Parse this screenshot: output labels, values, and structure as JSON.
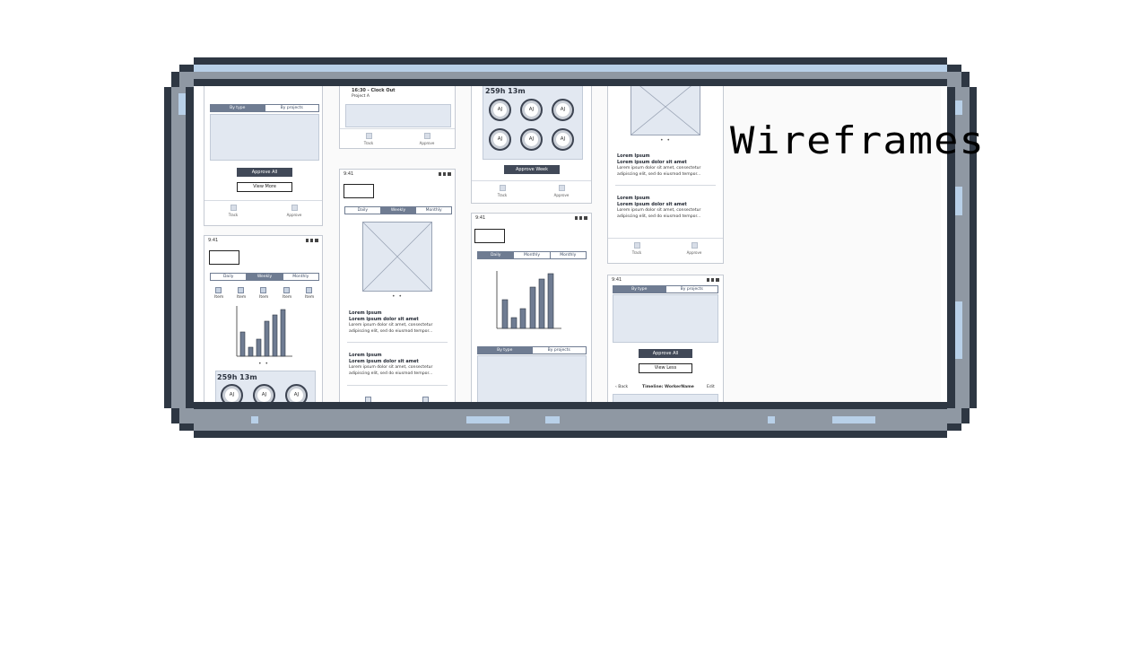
{
  "title": "Wireframes",
  "colors": {
    "frame_dark": "#2e3743",
    "frame_mid": "#8f98a3",
    "frame_light": "#b8d0e8",
    "accent": "#6f7c92",
    "panel": "#e2e8f1"
  },
  "common": {
    "time": "9:41",
    "tab_track": "Track",
    "tab_approve": "Approve",
    "by_type": "By type",
    "by_projects": "By projects",
    "daily": "Daily",
    "weekly": "Weekly",
    "monthly": "Monthly",
    "dots": "• •",
    "lorem_title": "Lorem Ipsum",
    "lorem_sub": "Lorem ipsum dolor sit amet",
    "lorem_body1": "Lorem ipsum dolor sit amet, consectetur",
    "lorem_body2": "adipiscing elit, sed do eiusmod tempor..."
  },
  "screen1": {
    "approve_all": "Approve All",
    "view_more": "View More"
  },
  "screen2": {
    "hours": "259h 13m",
    "avatar": "AJ",
    "items": [
      "Item",
      "Item",
      "Item",
      "Item",
      "Item"
    ]
  },
  "screen3": {
    "entry": "16:30 - Clock Out",
    "project": "Project A"
  },
  "screen5": {
    "hours": "259h 13m",
    "avatar": "AJ",
    "approve_week": "Approve Week"
  },
  "screen8": {
    "approve_all": "Approve All",
    "view_less": "View Less",
    "back": "Back",
    "timeline": "Timeline: WorkerName",
    "edit": "Edit"
  }
}
